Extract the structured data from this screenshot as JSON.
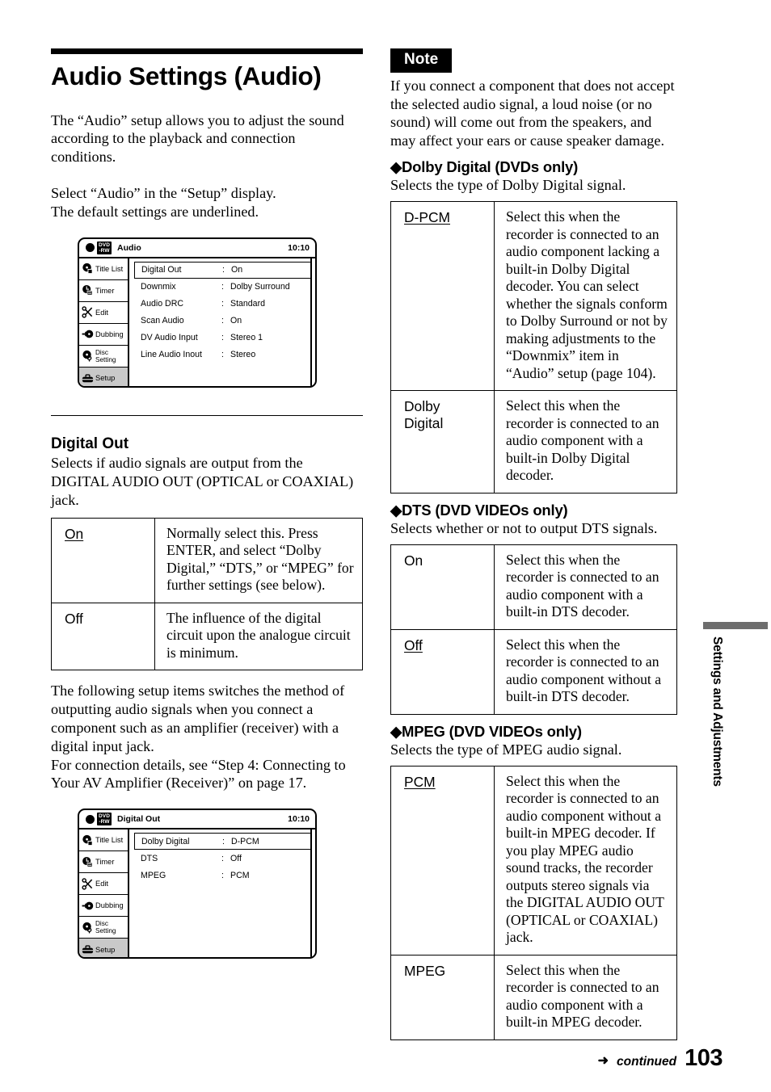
{
  "page": {
    "number": "103",
    "continued_label": "continued",
    "continued_arrow": "➜",
    "margin_tab_label": "Settings and Adjustments",
    "margin_bar_color": "#6e6e6e"
  },
  "left_column": {
    "title": "Audio Settings (Audio)",
    "intro_paragraph_1": "The “Audio” setup allows you to adjust the sound according to the playback and connection conditions.",
    "intro_paragraph_2": "Select “Audio” in the “Setup” display.\nThe default settings are underlined.",
    "section_heading": "Digital Out",
    "section_intro": "Selects if audio signals are output from the DIGITAL AUDIO OUT (OPTICAL or COAXIAL) jack.",
    "after_table_paragraph": "The following setup items switches the method of outputting audio signals when you connect a component such as an amplifier (receiver) with a digital input jack.\nFor connection details, see “Step 4: Connecting to Your AV Amplifier (Receiver)” on page 17.",
    "digital_out_table": [
      {
        "option": "On",
        "underlined": true,
        "description": "Normally select this. Press ENTER, and select “Dolby Digital,” “DTS,” or “MPEG” for further settings (see below)."
      },
      {
        "option": "Off",
        "underlined": false,
        "description": "The influence of the digital circuit upon the analogue circuit is minimum."
      }
    ]
  },
  "right_column": {
    "note": {
      "banner": "Note",
      "text": "If you connect a component that does not accept the selected audio signal, a loud noise (or no sound) will come out from the speakers, and may affect your ears or cause speaker damage."
    },
    "sections": [
      {
        "heading": "◆Dolby Digital (DVDs only)",
        "intro": "Selects the type of Dolby Digital signal.",
        "rows": [
          {
            "option": "D-PCM",
            "underlined": true,
            "description": "Select this when the recorder is connected to an audio component lacking a built-in Dolby Digital decoder. You can select whether the signals conform to Dolby Surround or not by making adjustments to the “Downmix” item in “Audio” setup (page 104)."
          },
          {
            "option": "Dolby\nDigital",
            "underlined": false,
            "description": "Select this when the recorder is connected to an audio component with a built-in Dolby Digital decoder."
          }
        ]
      },
      {
        "heading": "◆DTS (DVD VIDEOs only)",
        "intro": "Selects whether or not to output DTS signals.",
        "rows": [
          {
            "option": "On",
            "underlined": false,
            "description": "Select this when the recorder is connected to an audio component with a built-in DTS decoder."
          },
          {
            "option": "Off",
            "underlined": true,
            "description": "Select this when the recorder is connected to an audio component without a built-in DTS decoder."
          }
        ]
      },
      {
        "heading": "◆MPEG (DVD VIDEOs only)",
        "intro": "Selects the type of MPEG audio signal.",
        "rows": [
          {
            "option": "PCM",
            "underlined": true,
            "description": "Select this when the recorder is connected to an audio component without a built-in MPEG decoder. If you play MPEG audio sound tracks, the recorder outputs stereo signals via the DIGITAL AUDIO OUT (OPTICAL or COAXIAL) jack."
          },
          {
            "option": "MPEG",
            "underlined": false,
            "description": "Select this when the recorder is connected to an audio component with a built-in MPEG decoder."
          }
        ]
      }
    ]
  },
  "osd_screens": [
    {
      "disc_badge_line1": "DVD",
      "disc_badge_line2": "-RW",
      "title": "Audio",
      "clock": "10:10",
      "sidebar": [
        {
          "label": "Title List",
          "icon": "disc-title-list-icon",
          "selected": false
        },
        {
          "label": "Timer",
          "icon": "timer-clock-icon",
          "selected": false
        },
        {
          "label": "Edit",
          "icon": "scissors-edit-icon",
          "selected": false
        },
        {
          "label": "Dubbing",
          "icon": "dubbing-arrow-disc-icon",
          "selected": false
        },
        {
          "label": "Disc Setting",
          "icon": "disc-setting-icon",
          "selected": false
        },
        {
          "label": "Setup",
          "icon": "toolbox-setup-icon",
          "selected": true
        }
      ],
      "rows": [
        {
          "label": "Digital Out",
          "separator": ":",
          "value": "On",
          "highlighted": true
        },
        {
          "label": "Downmix",
          "separator": ":",
          "value": "Dolby Surround",
          "highlighted": false
        },
        {
          "label": "Audio DRC",
          "separator": ":",
          "value": "Standard",
          "highlighted": false
        },
        {
          "label": "Scan Audio",
          "separator": ":",
          "value": "On",
          "highlighted": false
        },
        {
          "label": "DV Audio  Input",
          "separator": ":",
          "value": "Stereo 1",
          "highlighted": false
        },
        {
          "label": "Line Audio Inout",
          "separator": ":",
          "value": "Stereo",
          "highlighted": false
        }
      ]
    },
    {
      "disc_badge_line1": "DVD",
      "disc_badge_line2": "-RW",
      "title": "Digital Out",
      "clock": "10:10",
      "sidebar": [
        {
          "label": "Title List",
          "icon": "disc-title-list-icon",
          "selected": false
        },
        {
          "label": "Timer",
          "icon": "timer-clock-icon",
          "selected": false
        },
        {
          "label": "Edit",
          "icon": "scissors-edit-icon",
          "selected": false
        },
        {
          "label": "Dubbing",
          "icon": "dubbing-arrow-disc-icon",
          "selected": false
        },
        {
          "label": "Disc Setting",
          "icon": "disc-setting-icon",
          "selected": false
        },
        {
          "label": "Setup",
          "icon": "toolbox-setup-icon",
          "selected": true
        }
      ],
      "rows": [
        {
          "label": "Dolby Digital",
          "separator": ":",
          "value": "D-PCM",
          "highlighted": true
        },
        {
          "label": "DTS",
          "separator": ":",
          "value": "Off",
          "highlighted": false
        },
        {
          "label": "MPEG",
          "separator": ":",
          "value": "PCM",
          "highlighted": false
        }
      ]
    }
  ]
}
